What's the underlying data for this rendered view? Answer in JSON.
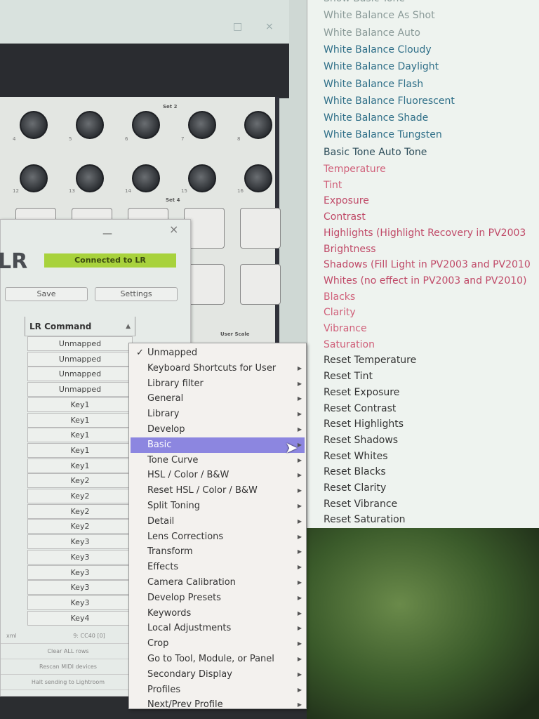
{
  "background_window": {
    "maximize_icon": "□",
    "close_icon": "×"
  },
  "controller": {
    "set_labels": [
      "Set 2",
      "Set 4"
    ],
    "knob_row1": [
      "4",
      "5",
      "6",
      "7",
      "8"
    ],
    "knob_row2": [
      "12",
      "13",
      "14",
      "15",
      "16"
    ],
    "user_scale": "User Scale"
  },
  "dialog": {
    "logo": "LR",
    "status": "Connected to LR",
    "status_color": "#a8d23c",
    "save": "Save",
    "settings": "Settings",
    "column_header": "LR Command",
    "rows": [
      "Unmapped",
      "Unmapped",
      "Unmapped",
      "Unmapped",
      "Key1",
      "Key1",
      "Key1",
      "Key1",
      "Key1",
      "Key2",
      "Key2",
      "Key2",
      "Key2",
      "Key3",
      "Key3",
      "Key3",
      "Key3",
      "Key3",
      "Key4"
    ],
    "footer_left": "xml",
    "footer_value": "9: CC40 [0]",
    "clear": "Clear ALL rows",
    "rescan": "Rescan MIDI devices",
    "halt": "Halt sending to Lightroom"
  },
  "menu": {
    "items": [
      {
        "label": "Unmapped",
        "checked": true
      },
      {
        "label": "Keyboard Shortcuts for User",
        "sub": true
      },
      {
        "label": "Library filter",
        "sub": true
      },
      {
        "label": "General",
        "sub": true
      },
      {
        "label": "Library",
        "sub": true
      },
      {
        "label": "Develop",
        "sub": true
      },
      {
        "label": "Basic",
        "sub": true,
        "selected": true
      },
      {
        "label": "Tone Curve",
        "sub": true
      },
      {
        "label": "HSL / Color / B&W",
        "sub": true
      },
      {
        "label": "Reset HSL / Color / B&W",
        "sub": true
      },
      {
        "label": "Split Toning",
        "sub": true
      },
      {
        "label": "Detail",
        "sub": true
      },
      {
        "label": "Lens Corrections",
        "sub": true
      },
      {
        "label": "Transform",
        "sub": true
      },
      {
        "label": "Effects",
        "sub": true
      },
      {
        "label": "Camera Calibration",
        "sub": true
      },
      {
        "label": "Develop Presets",
        "sub": true
      },
      {
        "label": "Keywords",
        "sub": true
      },
      {
        "label": "Local Adjustments",
        "sub": true
      },
      {
        "label": "Crop",
        "sub": true
      },
      {
        "label": "Go to Tool, Module, or Panel",
        "sub": true
      },
      {
        "label": "Secondary Display",
        "sub": true
      },
      {
        "label": "Profiles",
        "sub": true
      },
      {
        "label": "Next/Prev Profile",
        "sub": true
      }
    ],
    "check_icon": "✓",
    "submenu_arrow": "▶",
    "highlight_color": "#8c86e0"
  },
  "submenu": {
    "group_a": [
      {
        "label": "Show Basic Tone",
        "color": "#8a9a98"
      },
      {
        "label": "White Balance As Shot",
        "color": "#8a9a98"
      },
      {
        "label": "White Balance Auto",
        "color": "#8a9a98"
      },
      {
        "label": "White Balance Cloudy",
        "color": "#2f6f88"
      },
      {
        "label": "White Balance Daylight",
        "color": "#2f6f88"
      },
      {
        "label": "White Balance Flash",
        "color": "#2f6f88"
      },
      {
        "label": "White Balance Fluorescent",
        "color": "#2f6f88"
      },
      {
        "label": "White Balance Shade",
        "color": "#2f6f88"
      },
      {
        "label": "White Balance Tungsten",
        "color": "#2f6f88"
      },
      {
        "label": "Basic Tone Auto Tone",
        "color": "#2d4d5a"
      }
    ],
    "group_b": [
      {
        "label": "Temperature",
        "color": "#d0607a"
      },
      {
        "label": "Tint",
        "color": "#d0607a"
      },
      {
        "label": "Exposure",
        "color": "#c04a68"
      },
      {
        "label": "Contrast",
        "color": "#c04a68"
      },
      {
        "label": "Highlights (Highlight Recovery in PV2003",
        "color": "#c04a68"
      },
      {
        "label": "Brightness",
        "color": "#c04a68"
      },
      {
        "label": "Shadows (Fill Light in PV2003 and PV2010",
        "color": "#c04a68"
      },
      {
        "label": "Whites (no effect in PV2003 and PV2010)",
        "color": "#c04a68"
      },
      {
        "label": "Blacks",
        "color": "#d0607a"
      },
      {
        "label": "Clarity",
        "color": "#d0607a"
      },
      {
        "label": "Vibrance",
        "color": "#d0607a"
      },
      {
        "label": "Saturation",
        "color": "#d0607a"
      },
      {
        "label": "Reset Temperature",
        "color": "#333"
      },
      {
        "label": "Reset Tint",
        "color": "#333"
      },
      {
        "label": "Reset Exposure",
        "color": "#333"
      },
      {
        "label": "Reset Contrast",
        "color": "#333"
      },
      {
        "label": "Reset Highlights",
        "color": "#333"
      },
      {
        "label": "Reset Shadows",
        "color": "#333"
      },
      {
        "label": "Reset Whites",
        "color": "#333"
      },
      {
        "label": "Reset Blacks",
        "color": "#333"
      },
      {
        "label": "Reset Clarity",
        "color": "#333"
      },
      {
        "label": "Reset Vibrance",
        "color": "#333"
      },
      {
        "label": "Reset Saturation",
        "color": "#333"
      }
    ]
  }
}
